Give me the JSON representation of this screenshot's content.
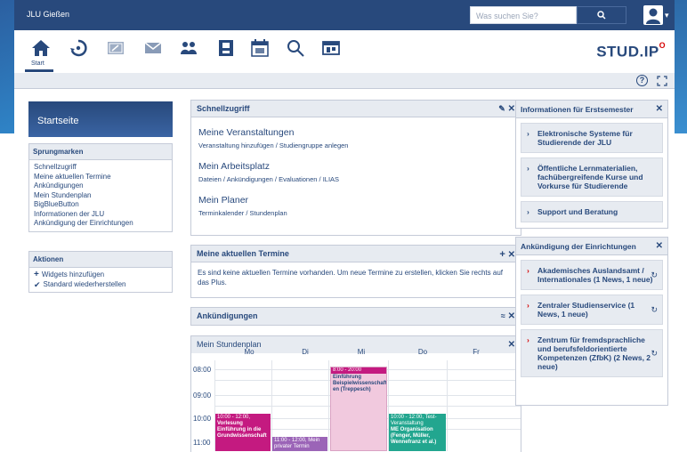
{
  "topbar": {
    "site_name": "JLU Gießen",
    "search_placeholder": "Was suchen Sie?",
    "search_button_icon": "search-icon",
    "avatar_icon": "user-icon"
  },
  "nav": {
    "items": [
      {
        "icon": "home-icon",
        "label": "Start"
      },
      {
        "icon": "activity-icon"
      },
      {
        "icon": "courses-icon"
      },
      {
        "icon": "messages-icon"
      },
      {
        "icon": "community-icon"
      },
      {
        "icon": "profile-icon"
      },
      {
        "icon": "calendar-icon"
      },
      {
        "icon": "search-icon"
      },
      {
        "icon": "tools-icon"
      }
    ],
    "logo_text": "STUD.IP"
  },
  "toolbar": {
    "help_icon": "help-icon",
    "fullscreen_icon": "fullscreen-icon"
  },
  "sidebar": {
    "title": "Startseite",
    "jumpmarks_header": "Sprungmarken",
    "jumpmarks": [
      "Schnellzugriff",
      "Meine aktuellen Termine",
      "Ankündigungen",
      "Mein Stundenplan",
      "BigBlueButton",
      "Informationen der JLU",
      "Ankündigung der Einrichtungen"
    ],
    "actions_header": "Aktionen",
    "actions": [
      {
        "icon": "plus-icon",
        "label": "Widgets hinzufügen"
      },
      {
        "icon": "check-icon",
        "label": "Standard wiederherstellen"
      }
    ]
  },
  "quickaccess": {
    "title": "Schnellzugriff",
    "groups": [
      {
        "title": "Meine Veranstaltungen",
        "links": "Veranstaltung hinzufügen / Studiengruppe anlegen"
      },
      {
        "title": "Mein Arbeitsplatz",
        "links": "Dateien / Ankündigungen / Evaluationen / ILIAS"
      },
      {
        "title": "Mein Planer",
        "links": "Terminkalender / Stundenplan"
      }
    ]
  },
  "termine": {
    "title": "Meine aktuellen Termine",
    "text": "Es sind keine aktuellen Termine vorhanden. Um neue Termine zu erstellen, klicken Sie rechts auf das Plus."
  },
  "announcements": {
    "title": "Ankündigungen"
  },
  "timetable": {
    "title": "Mein Stundenplan",
    "days": [
      "Mo",
      "Di",
      "Mi",
      "Do",
      "Fr"
    ],
    "times": [
      "08:00",
      "09:00",
      "10:00",
      "11:00"
    ],
    "events": [
      {
        "time": "8:00 - 20:00",
        "title": "Einführung Beispielwissenschaft en (Treppesch)",
        "color": "#f1c9de"
      },
      {
        "time": "10:00 - 12:00,",
        "title": "Vorlesung Einführung in die Grundwissenschaft",
        "color": "#c41a80"
      },
      {
        "time": "10:00 - 12:00, Test-Veranstaltung",
        "title": "ME Organisation (Fenger, Müller, Wennefranz et al.)",
        "color": "#22a68f"
      },
      {
        "time": "11:00 - 12:00, Mein privater Termin",
        "title": "",
        "color": "#9b64b7"
      }
    ]
  },
  "info_first_year": {
    "title": "Informationen für Erstsemester",
    "items": [
      "Elektronische Systeme für Studierende der JLU",
      "Öffentliche Lernmaterialien, fachübergreifende Kurse und Vorkurse für Studierende",
      "Support und Beratung"
    ]
  },
  "institutes": {
    "title": "Ankündigung der Einrichtungen",
    "items": [
      "Akademisches Auslandsamt / Internationales (1 News, 1 neue)",
      "Zentraler Studienservice (1 News, 1 neue)",
      "Zentrum für fremdsprachliche und berufsfeldorientierte Kompetenzen (ZfbK) (2 News, 2 neue)"
    ]
  },
  "colors": {
    "brand_blue": "#28497c",
    "panel_gray": "#e7ebf1",
    "accent_red": "#d60000"
  }
}
